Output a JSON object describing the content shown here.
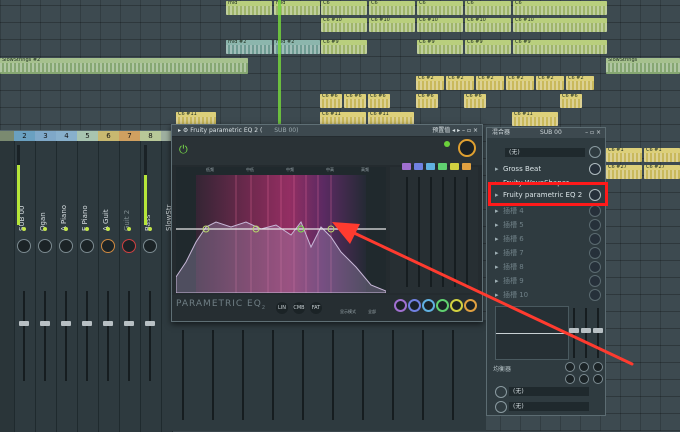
{
  "playlist": {
    "clips_top": [
      "mid",
      "mid",
      "C6",
      "C6",
      "C6",
      "C6",
      "C6"
    ],
    "clips_row2": [
      "C6 #10",
      "C6 #10",
      "C6 #10",
      "C6 #10",
      "C6 #10"
    ],
    "clips_row3": [
      "mid #2",
      "mid #2",
      "C6 #9",
      "C6 #9",
      "C6 #9",
      "C6 #9"
    ],
    "strings_left": "SlowStrings #2",
    "strings_right": "SlowStrings",
    "row_c6_2": [
      "C6 #2",
      "C6 #2",
      "C6 #2",
      "C6 #2",
      "C6 #2",
      "C6 #2"
    ],
    "row_c6_6": [
      "C6 #6",
      "C6 #6",
      "C6 #6",
      "C6 #6",
      "C6 #6",
      "C6 #6"
    ],
    "row_c6_11": [
      "C6 #11",
      "C6 #11",
      "C6 #11",
      "C6 #11"
    ],
    "row_c6_12": [
      "C6 #12",
      "C6 #12",
      "C6 #12",
      "C6 #12"
    ],
    "right_clips": [
      "C6 #1",
      "C6 #1",
      "C6 #27",
      "C6 #27"
    ]
  },
  "mixer": {
    "strip_numbers": [
      "2",
      "3",
      "4",
      "5",
      "6",
      "7",
      "8"
    ],
    "strip_labels": [
      "SUB 00",
      "Ogan",
      "A Piano",
      "E Piano",
      "A Guit",
      "Guit 2",
      "Bass",
      "SlowStr"
    ]
  },
  "eq_window": {
    "title": "Fruity parametric EQ 2 (",
    "subtitle": "SUB 00)",
    "preset_label": "预置值",
    "freq_labels": [
      "低频",
      "中低",
      "中频",
      "中高",
      "高频"
    ],
    "brand": "PARAMETRIC EQ",
    "brand_sub": "2",
    "footer_buttons": [
      "LIN",
      "CMB",
      "FAT"
    ],
    "footer_labels": [
      "显示模式",
      "全部"
    ]
  },
  "channel_panel": {
    "title": "混合器",
    "sub": "SUB 00",
    "input": "(无)",
    "slots": [
      {
        "label": "Gross Beat",
        "empty": false
      },
      {
        "label": "Fruity WaveShaper",
        "empty": false
      },
      {
        "label": "Fruity parametric EQ 2",
        "empty": false
      },
      {
        "label": "插槽 4",
        "empty": true
      },
      {
        "label": "插槽 5",
        "empty": true
      },
      {
        "label": "插槽 6",
        "empty": true
      },
      {
        "label": "插槽 7",
        "empty": true
      },
      {
        "label": "插槽 8",
        "empty": true
      },
      {
        "label": "插槽 9",
        "empty": true
      },
      {
        "label": "插槽 10",
        "empty": true
      }
    ],
    "eq_label": "均衡器",
    "output_1": "(无)",
    "output_2": "(无)"
  },
  "colors": {
    "highlight": "#ff1a1a",
    "arrow": "#ff3b2f",
    "accent_green": "#b6e63a"
  }
}
